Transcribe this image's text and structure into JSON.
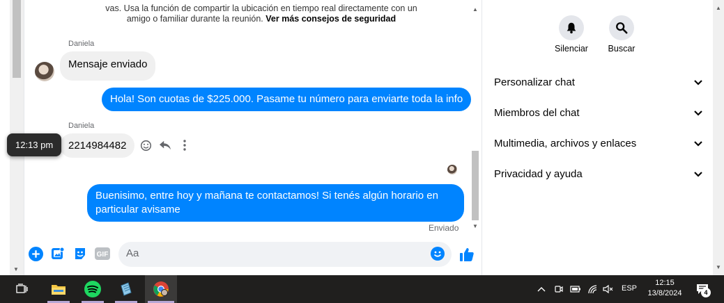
{
  "chat": {
    "safety_line1": "vas. Usa la función de compartir la ubicación en tiempo real directamente con un",
    "safety_line2": "amigo o familiar durante la reunión.",
    "safety_link": "Ver más consejos de seguridad",
    "messages": [
      {
        "sender": "Daniela",
        "text": "Mensaje enviado"
      },
      {
        "text": "Hola! Son cuotas de $225.000. Pasame tu número para enviarte toda la info"
      },
      {
        "sender": "Daniela",
        "text": "2214984482"
      },
      {
        "text": "Buenisimo, entre hoy y mañana te contactamos! Si tenés algún horario en particular avisame"
      }
    ],
    "tooltip_time": "12:13 pm",
    "status": "Enviado",
    "composer_placeholder": "Aa",
    "gif_label": "GIF"
  },
  "panel": {
    "actions": [
      {
        "label": "Silenciar",
        "icon": "bell-icon"
      },
      {
        "label": "Buscar",
        "icon": "search-icon"
      }
    ],
    "menu": [
      {
        "label": "Personalizar chat"
      },
      {
        "label": "Miembros del chat"
      },
      {
        "label": "Multimedia, archivos y enlaces"
      },
      {
        "label": "Privacidad y ayuda"
      }
    ]
  },
  "taskbar": {
    "lang": "ESP",
    "time": "12:15",
    "date": "13/8/2024",
    "notifications": "4"
  },
  "colors": {
    "accent": "#0084ff",
    "incoming_bubble": "#f0f0f0",
    "taskbar": "#201f1e"
  }
}
